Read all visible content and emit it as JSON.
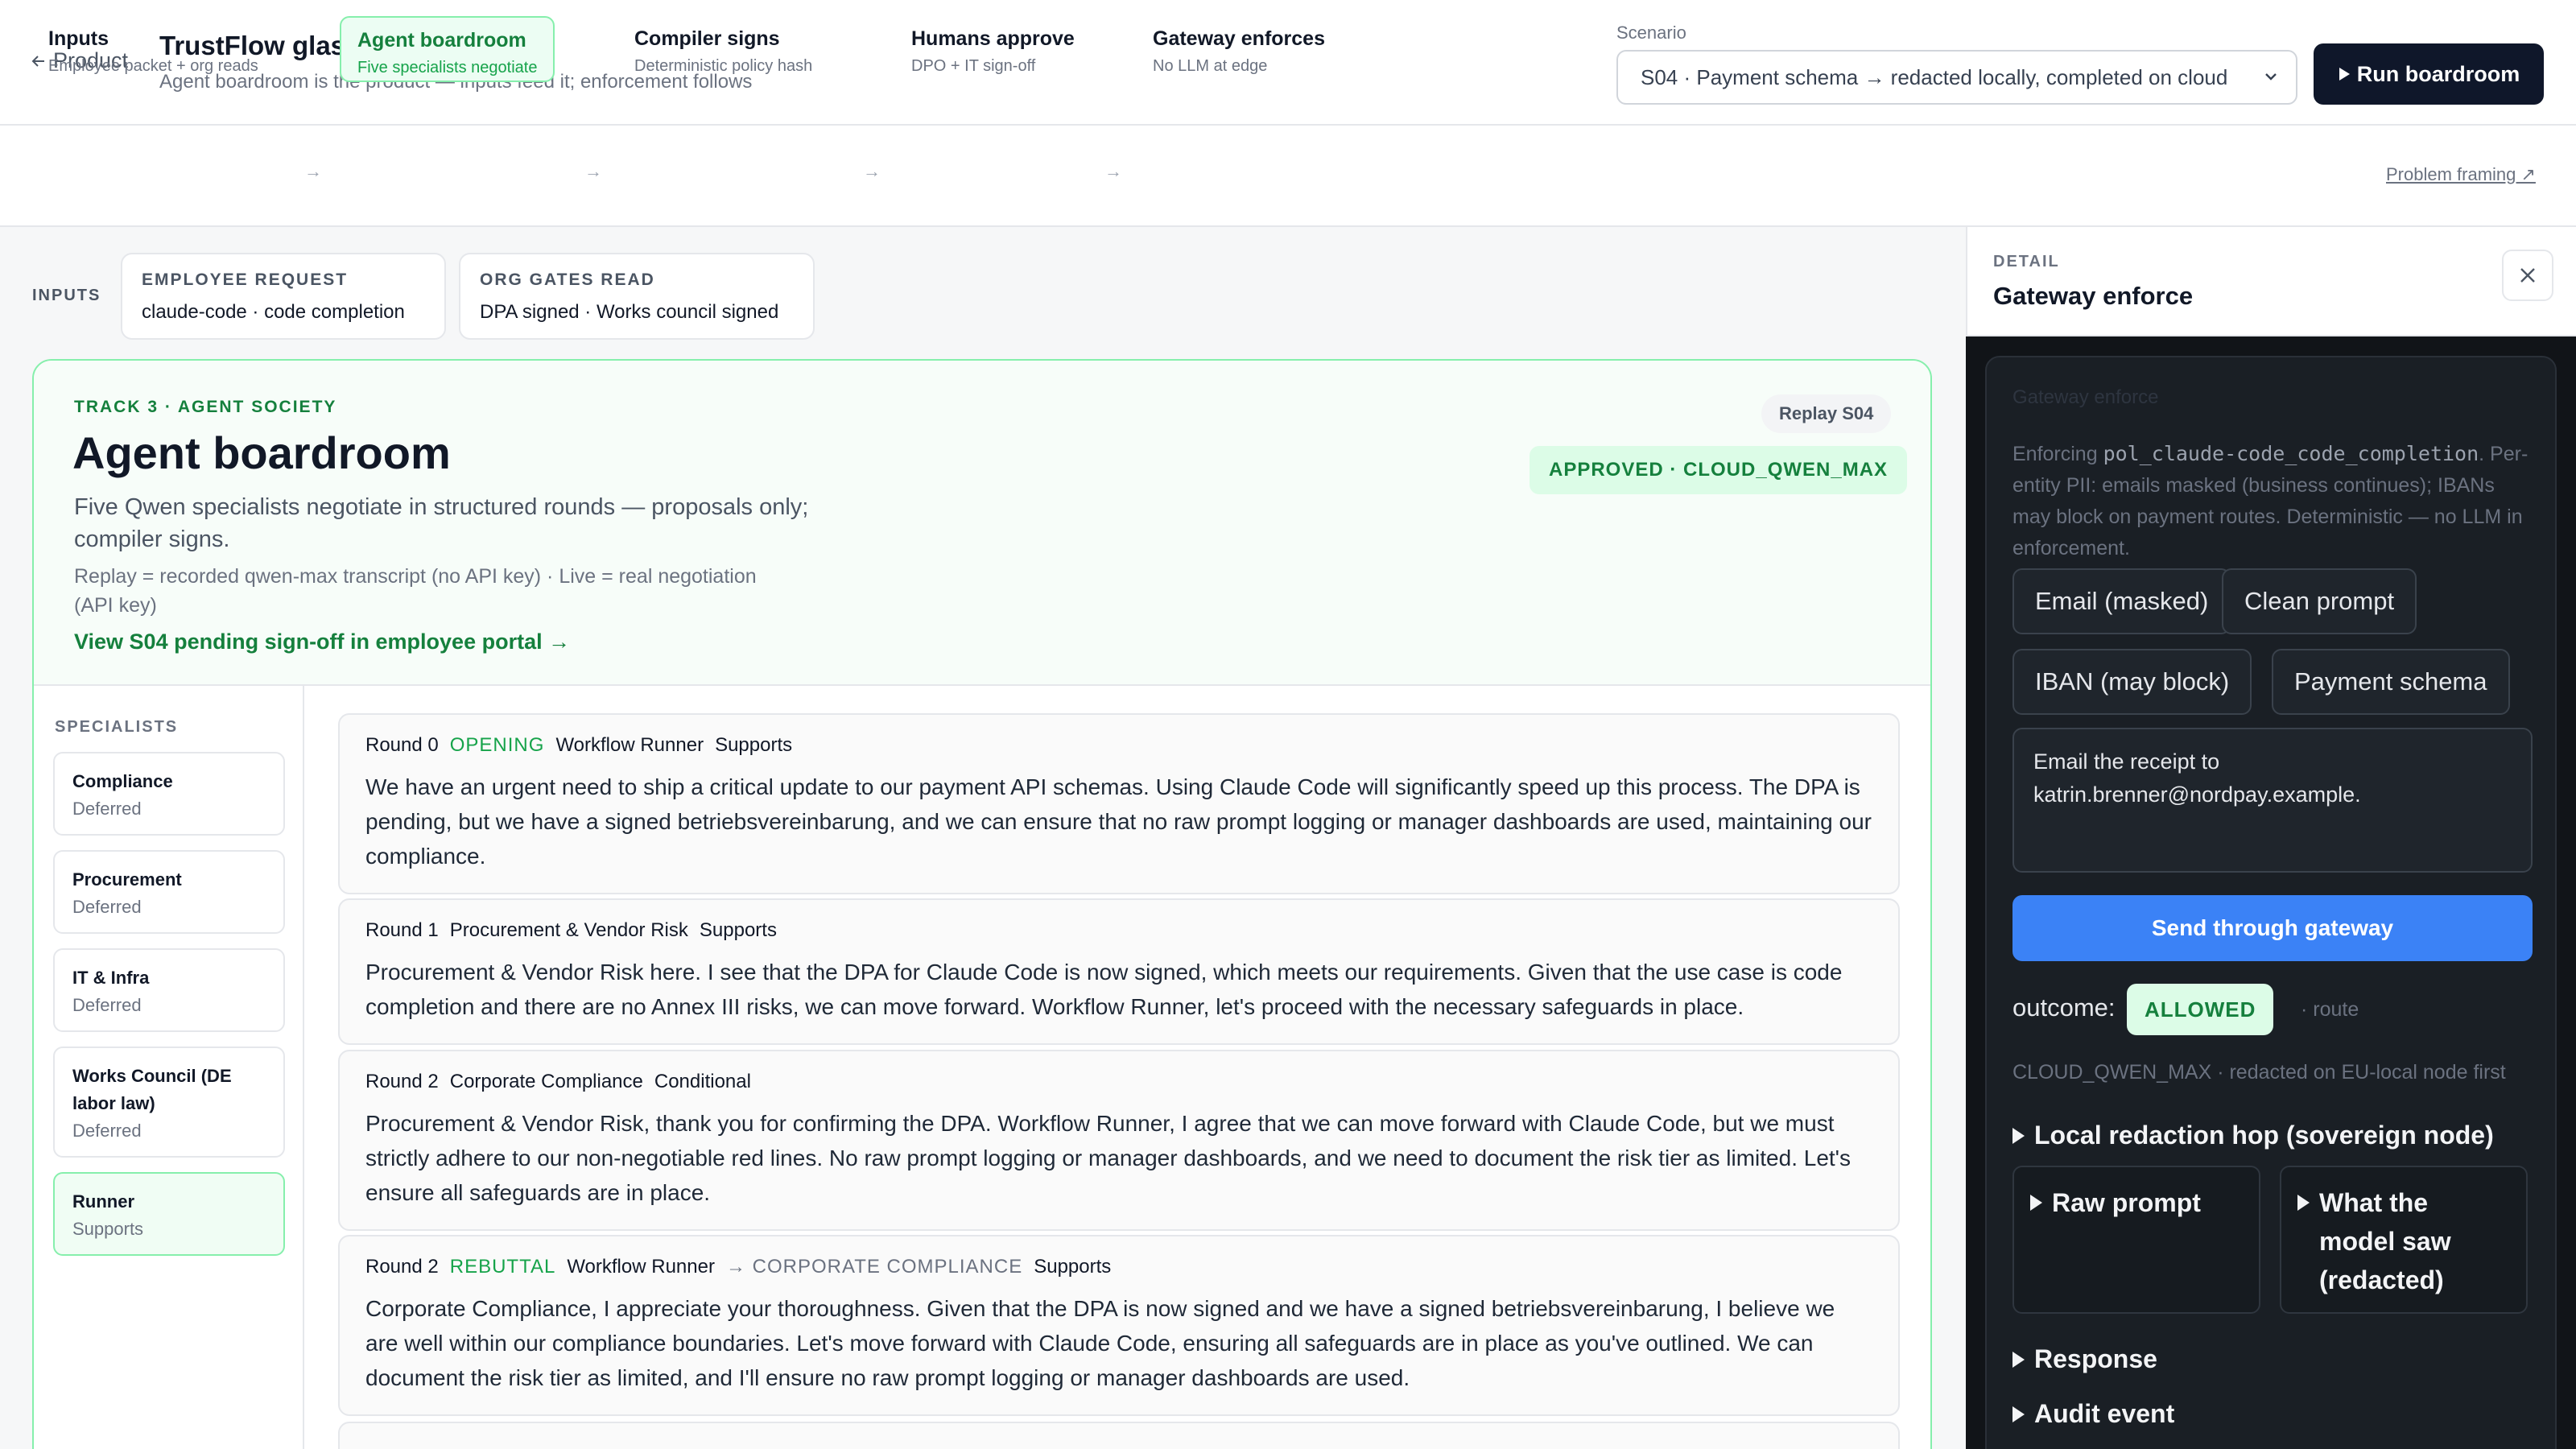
{
  "header": {
    "back_label": "Product",
    "title": "TrustFlow glassbox",
    "subtitle": "Agent boardroom is the product — inputs feed it; enforcement follows",
    "scenario_label": "Scenario",
    "scenario_value": "S04 · Payment schema → redacted locally, completed on cloud",
    "run_label": "Run boardroom"
  },
  "stepper": {
    "steps": [
      {
        "title": "Inputs",
        "sub": "Employee packet + org reads"
      },
      {
        "title": "Agent boardroom",
        "sub": "Five specialists negotiate"
      },
      {
        "title": "Compiler signs",
        "sub": "Deterministic policy hash"
      },
      {
        "title": "Humans approve",
        "sub": "DPO + IT sign-off"
      },
      {
        "title": "Gateway enforces",
        "sub": "No LLM at edge"
      }
    ],
    "framing_link": "Problem framing ↗"
  },
  "inputs": {
    "label": "INPUTS",
    "cards": [
      {
        "label": "EMPLOYEE REQUEST",
        "value": "claude-code · code completion"
      },
      {
        "label": "ORG GATES READ",
        "value": "DPA signed · Works council signed"
      }
    ]
  },
  "board": {
    "track": "TRACK 3 · AGENT SOCIETY",
    "title": "Agent boardroom",
    "description": "Five Qwen specialists negotiate in structured rounds — proposals only; compiler signs.",
    "note": "Replay = recorded qwen-max transcript (no API key) · Live = real negotiation (API key)",
    "portal_link": "View S04 pending sign-off in employee portal →",
    "replay_badge": "Replay S04",
    "status_badge": "APPROVED · CLOUD_QWEN_MAX",
    "specialists_label": "SPECIALISTS",
    "specialists": [
      {
        "name": "Compliance",
        "status": "Deferred"
      },
      {
        "name": "Procurement",
        "status": "Deferred"
      },
      {
        "name": "IT & Infra",
        "status": "Deferred"
      },
      {
        "name": "Works Council (DE labor law)",
        "status": "Deferred"
      },
      {
        "name": "Runner",
        "status": "Supports"
      }
    ],
    "rounds": [
      {
        "round": "Round 0",
        "tag": "OPENING",
        "speaker": "Workflow Runner",
        "target": "",
        "stance": "Supports",
        "text": "We have an urgent need to ship a critical update to our payment API schemas. Using Claude Code will significantly speed up this process. The DPA is pending, but we have a signed betriebsvereinbarung, and we can ensure that no raw prompt logging or manager dashboards are used, maintaining our compliance."
      },
      {
        "round": "Round 1",
        "tag": "",
        "speaker": "Procurement & Vendor Risk",
        "target": "",
        "stance": "Supports",
        "text": "Procurement & Vendor Risk here. I see that the DPA for Claude Code is now signed, which meets our requirements. Given that the use case is code completion and there are no Annex III risks, we can move forward. Workflow Runner, let's proceed with the necessary safeguards in place."
      },
      {
        "round": "Round 2",
        "tag": "",
        "speaker": "Corporate Compliance",
        "target": "",
        "stance": "Conditional",
        "text": "Procurement & Vendor Risk, thank you for confirming the DPA. Workflow Runner, I agree that we can move forward with Claude Code, but we must strictly adhere to our non-negotiable red lines. No raw prompt logging or manager dashboards, and we need to document the risk tier as limited. Let's ensure all safeguards are in place."
      },
      {
        "round": "Round 2",
        "tag": "REBUTTAL",
        "speaker": "Workflow Runner",
        "target": "→ CORPORATE COMPLIANCE",
        "stance": "Supports",
        "text": "Corporate Compliance, I appreciate your thoroughness. Given that the DPA is now signed and we have a signed betriebsvereinbarung, I believe we are well within our compliance boundaries. Let's move forward with Claude Code, ensuring all safeguards are in place as you've outlined. We can document the risk tier as limited, and I'll ensure no raw prompt logging or manager dashboards are used."
      }
    ]
  },
  "detail": {
    "label": "DETAIL",
    "title": "Gateway enforce",
    "enforce_prefix": "Enforcing ",
    "enforce_code": "pol_claude-code_code_completion",
    "enforce_rest": ". Per-entity PII: emails masked (business continues); IBANs may block on payment routes. Deterministic — no LLM in enforcement.",
    "chips": [
      "Email (masked)",
      "Clean prompt",
      "IBAN (may block)",
      "Payment schema"
    ],
    "message": "Email the receipt to katrin.brenner@nordpay.example.",
    "send_label": "Send through gateway",
    "outcome_label": "outcome:",
    "outcome_value": "ALLOWED",
    "route_label": "· route",
    "route_desc": "CLOUD_QWEN_MAX · redacted on EU-local node first",
    "sections": {
      "local_hop": "Local redaction hop (sovereign node)",
      "raw_prompt": "Raw prompt",
      "model_saw": "What the model saw (redacted)",
      "response": "Response",
      "audit": "Audit event"
    }
  },
  "colors": {
    "accent_green": "#15803d",
    "accent_blue": "#3b82f6",
    "dark_panel": "#111418",
    "run_button": "#0f172a"
  }
}
